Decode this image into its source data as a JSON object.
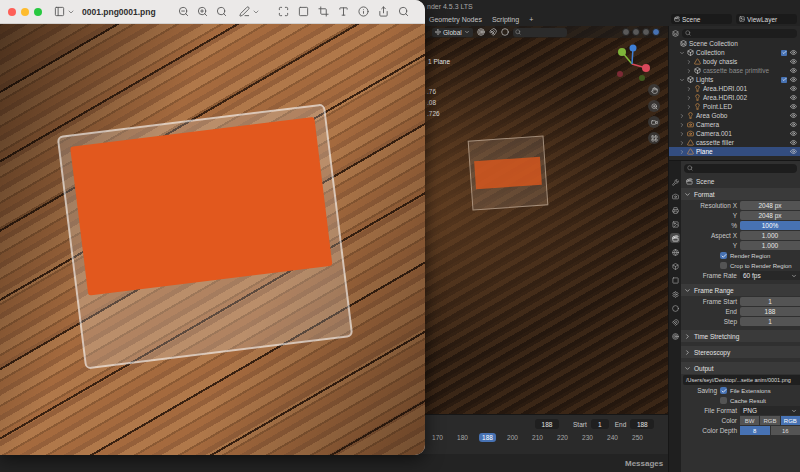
{
  "preview": {
    "title": "0001.png0001.png"
  },
  "blender": {
    "title": "nder 4.5.3 LTS",
    "workspaces": [
      {
        "label": "Geometry Nodes",
        "selected": false
      },
      {
        "label": "Scripting",
        "selected": false
      }
    ],
    "add_workspace": "+",
    "scene": "Scene",
    "view_layer": "ViewLayer",
    "viewport": {
      "orientation": "Global",
      "object_label": "1 Plane",
      "readouts": [
        ".76",
        ".08",
        ".726"
      ]
    },
    "timeline": {
      "current": "188",
      "start_label": "Start",
      "start": "1",
      "end_label": "End",
      "end": "188",
      "ticks": [
        {
          "label": "170",
          "selected": false
        },
        {
          "label": "180",
          "selected": false
        },
        {
          "label": "188",
          "selected": true
        },
        {
          "label": "200",
          "selected": false
        },
        {
          "label": "210",
          "selected": false
        },
        {
          "label": "220",
          "selected": false
        },
        {
          "label": "230",
          "selected": false
        },
        {
          "label": "240",
          "selected": false
        },
        {
          "label": "250",
          "selected": false
        }
      ]
    },
    "status_bar": {
      "messages": "Messages"
    },
    "outliner": {
      "items": [
        {
          "label": "Scene Collection",
          "depth": 0,
          "kind": "scene",
          "selected": false
        },
        {
          "label": "Collection",
          "depth": 1,
          "kind": "collection",
          "expanded": true,
          "checked": true,
          "selected": false
        },
        {
          "label": "body chasis",
          "depth": 2,
          "kind": "mesh",
          "expanded": false,
          "selected": false
        },
        {
          "label": "cassette base primitive",
          "depth": 2,
          "kind": "collection",
          "expanded": false,
          "selected": false,
          "disabled": true
        },
        {
          "label": "Lights",
          "depth": 1,
          "kind": "collection",
          "expanded": true,
          "checked": true,
          "selected": false
        },
        {
          "label": "Area.HDRI.001",
          "depth": 2,
          "kind": "light",
          "expanded": false,
          "selected": false
        },
        {
          "label": "Area.HDRI.002",
          "depth": 2,
          "kind": "light",
          "expanded": false,
          "selected": false
        },
        {
          "label": "Point.LED",
          "depth": 2,
          "kind": "light",
          "expanded": false,
          "selected": false
        },
        {
          "label": "Area Gobo",
          "depth": 1,
          "kind": "light",
          "expanded": false,
          "selected": false
        },
        {
          "label": "Camera",
          "depth": 1,
          "kind": "camera",
          "expanded": false,
          "selected": false
        },
        {
          "label": "Camera.001",
          "depth": 1,
          "kind": "camera",
          "expanded": false,
          "selected": false
        },
        {
          "label": "cassette filler",
          "depth": 1,
          "kind": "mesh",
          "expanded": false,
          "selected": false
        },
        {
          "label": "Plane",
          "depth": 1,
          "kind": "mesh",
          "expanded": false,
          "selected": true
        }
      ]
    },
    "properties": {
      "tabs": [
        {
          "selected": false
        },
        {
          "selected": false
        },
        {
          "selected": false
        },
        {
          "selected": false
        },
        {
          "selected": true
        },
        {
          "selected": false
        },
        {
          "selected": false
        },
        {
          "selected": false
        },
        {
          "selected": false
        },
        {
          "selected": false
        },
        {
          "selected": false
        },
        {
          "selected": false
        }
      ],
      "context": "Scene",
      "sections": [
        {
          "title": "Format",
          "expanded": true,
          "rows": [
            {
              "kind": "field",
              "label": "Resolution X",
              "value": "2048 px"
            },
            {
              "kind": "field",
              "label": "Y",
              "value": "2048 px"
            },
            {
              "kind": "slider",
              "label": "%",
              "value": "100%",
              "level": 1
            },
            {
              "kind": "field",
              "label": "Aspect X",
              "value": "1.000"
            },
            {
              "kind": "field",
              "label": "Y",
              "value": "1.000"
            },
            {
              "kind": "check",
              "label": "Render Region",
              "checked": true
            },
            {
              "kind": "check",
              "label": "Crop to Render Region",
              "checked": false
            },
            {
              "kind": "enum",
              "label": "Frame Rate",
              "value": "60 fps"
            }
          ]
        },
        {
          "title": "Frame Range",
          "expanded": true,
          "rows": [
            {
              "kind": "field",
              "label": "Frame Start",
              "value": "1"
            },
            {
              "kind": "field",
              "label": "End",
              "value": "188"
            },
            {
              "kind": "field",
              "label": "Step",
              "value": "1"
            }
          ]
        },
        {
          "title": "Time Stretching",
          "expanded": false,
          "rows": []
        },
        {
          "title": "Stereoscopy",
          "expanded": false,
          "rows": []
        },
        {
          "title": "Output",
          "expanded": true,
          "rows": [
            {
              "kind": "path",
              "value": "/Users/seyi/Desktop/...sette anim/0001.png"
            },
            {
              "kind": "check",
              "heading": "Saving",
              "label": "File Extensions",
              "checked": true
            },
            {
              "kind": "check",
              "label": "Cache Result",
              "checked": false
            },
            {
              "kind": "enum",
              "label": "File Format",
              "value": "PNG"
            },
            {
              "kind": "buttons",
              "label": "Color",
              "options": [
                {
                  "label": "BW",
                  "selected": false
                },
                {
                  "label": "RGB",
                  "selected": false
                },
                {
                  "label": "RGB",
                  "selected": true
                }
              ]
            },
            {
              "kind": "buttons",
              "label": "Color Depth",
              "options": [
                {
                  "label": "8",
                  "selected": true
                },
                {
                  "label": "16",
                  "selected": false
                }
              ]
            }
          ]
        }
      ]
    }
  }
}
